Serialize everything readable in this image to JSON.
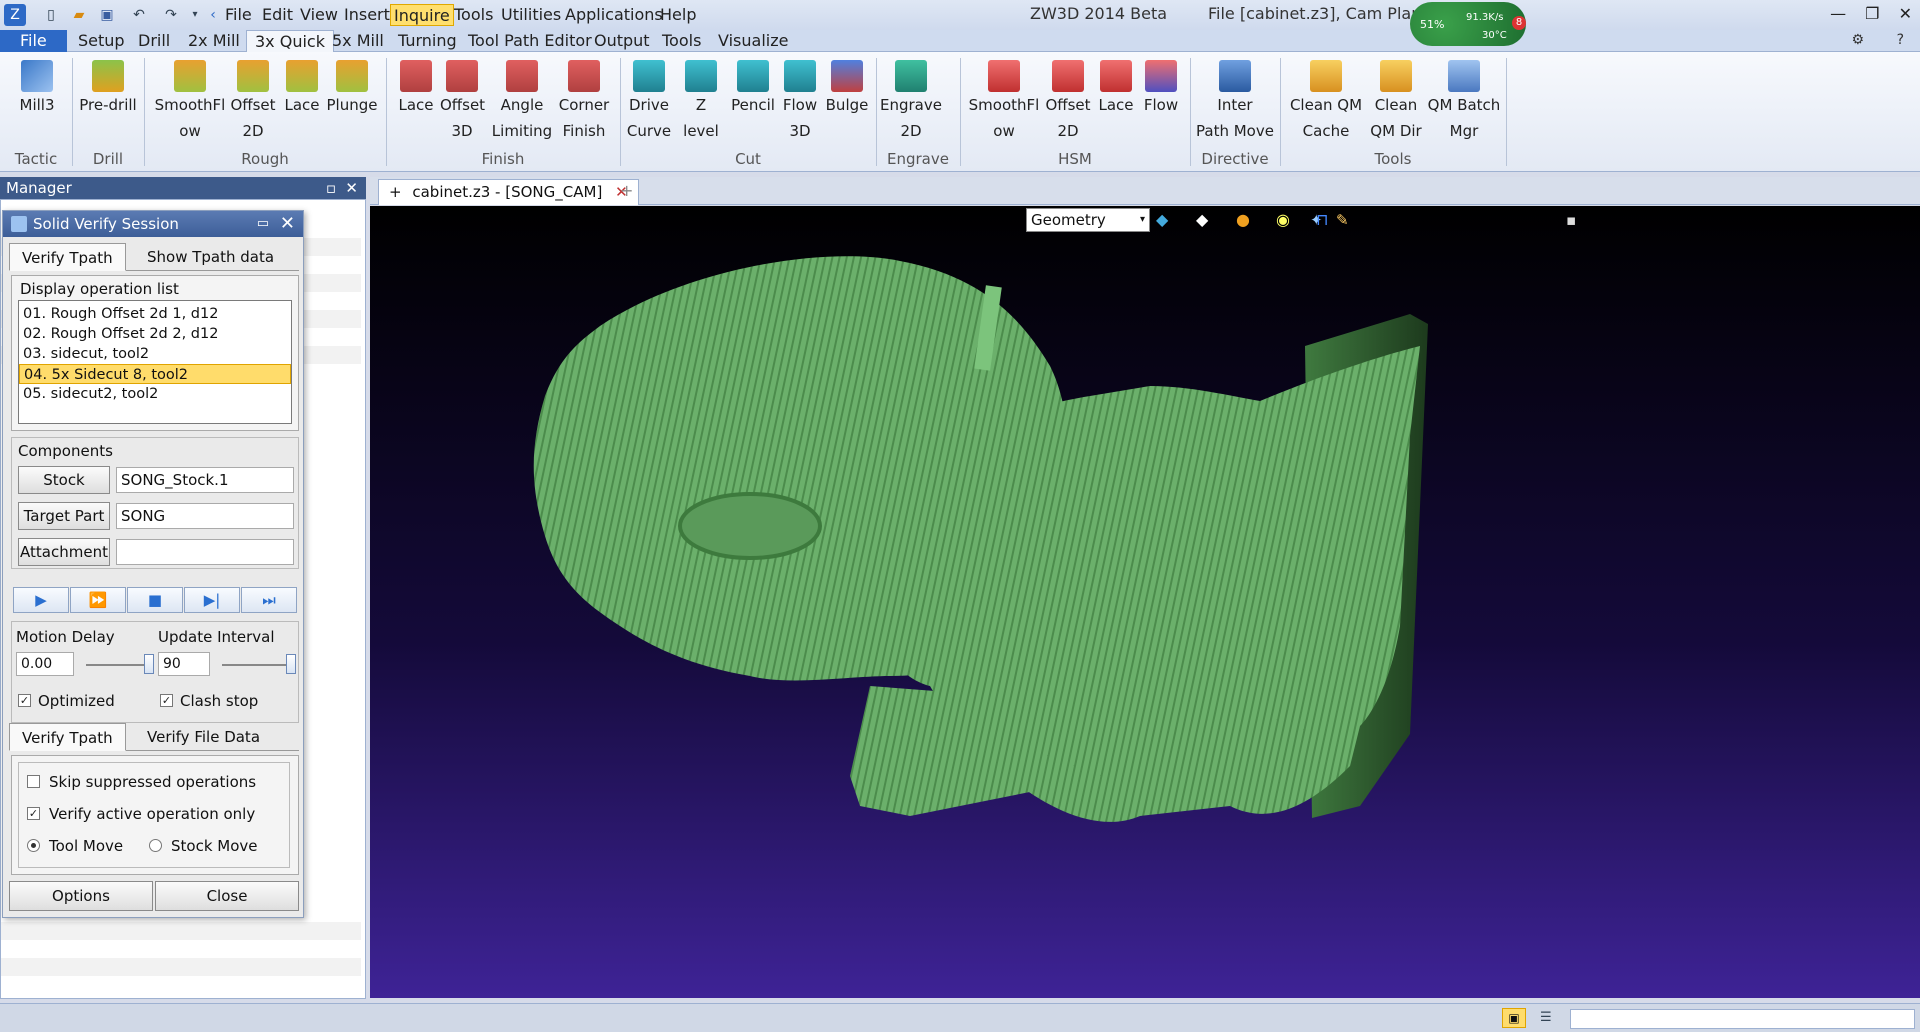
{
  "titlebar": {
    "app_title": "ZW3D 2014 Beta",
    "file_info": "File [cabinet.z3],  Cam Plan [SONG_CAM]",
    "menu": [
      "File",
      "Edit",
      "View",
      "Insert",
      "Inquire",
      "Tools",
      "Utilities",
      "Applications",
      "Help"
    ],
    "active_menu": "Inquire",
    "widget": {
      "cpu": "51%",
      "net": "91.3K/s",
      "temp": "30°C",
      "badge": "8"
    }
  },
  "ribbon_tabs": [
    "File",
    "Setup",
    "Drill",
    "2x Mill",
    "3x Quick",
    "5x Mill",
    "Turning",
    "Tool Path Editor",
    "Output",
    "Tools",
    "Visualize"
  ],
  "ribbon": {
    "buttons": [
      {
        "l1": "Mill3",
        "l2": "",
        "color": "#3a78c8"
      },
      {
        "l1": "Pre-drill",
        "l2": "",
        "color": "#e0a020"
      },
      {
        "l1": "SmoothFl",
        "l2": "ow",
        "color": "#d8c040"
      },
      {
        "l1": "Offset",
        "l2": "2D",
        "color": "#d8c040"
      },
      {
        "l1": "Lace",
        "l2": "",
        "color": "#d8c040"
      },
      {
        "l1": "Plunge",
        "l2": "",
        "color": "#d8c040"
      },
      {
        "l1": "Lace",
        "l2": "",
        "color": "#c05050"
      },
      {
        "l1": "Offset",
        "l2": "3D",
        "color": "#c05050"
      },
      {
        "l1": "Angle",
        "l2": "Limiting",
        "color": "#c05050"
      },
      {
        "l1": "Corner",
        "l2": "Finish",
        "color": "#c05050"
      },
      {
        "l1": "Drive",
        "l2": "Curve",
        "color": "#30a0b0"
      },
      {
        "l1": "Z level",
        "l2": "",
        "color": "#30a0b0"
      },
      {
        "l1": "Pencil",
        "l2": "",
        "color": "#30a0b0"
      },
      {
        "l1": "Flow",
        "l2": "3D",
        "color": "#30a0b0"
      },
      {
        "l1": "Bulge",
        "l2": "",
        "color": "#3060c0"
      },
      {
        "l1": "Engrave",
        "l2": "2D",
        "color": "#30a0b0"
      },
      {
        "l1": "SmoothFl",
        "l2": "ow",
        "color": "#d04848"
      },
      {
        "l1": "Offset",
        "l2": "2D",
        "color": "#d04848"
      },
      {
        "l1": "Lace",
        "l2": "",
        "color": "#d04848"
      },
      {
        "l1": "Flow",
        "l2": "",
        "color": "#d04848"
      },
      {
        "l1": "Inter",
        "l2": "Path Move",
        "color": "#3a78c8"
      },
      {
        "l1": "Clean QM",
        "l2": "Cache",
        "color": "#e8b830"
      },
      {
        "l1": "Clean",
        "l2": "QM Dir",
        "color": "#e8b830"
      },
      {
        "l1": "QM Batch",
        "l2": "Mgr",
        "color": "#5a8ad0"
      }
    ],
    "groups": [
      "Tactic",
      "Drill",
      "Rough",
      "Finish",
      "Cut",
      "Engrave",
      "HSM",
      "Directive",
      "Tools"
    ]
  },
  "manager": {
    "title": "Manager"
  },
  "dialog": {
    "title": "Solid Verify Session",
    "tabs1": [
      "Verify Tpath",
      "Show Tpath data"
    ],
    "oplist_label": "Display operation list",
    "operations": [
      "01. Rough Offset 2d 1, d12",
      "02. Rough Offset 2d 2, d12",
      "03. sidecut, tool2",
      "04. 5x Sidecut 8, tool2",
      "05. sidecut2, tool2"
    ],
    "selected_op": "04. 5x Sidecut 8, tool2",
    "components_label": "Components",
    "stock_btn": "Stock",
    "stock_val": "SONG_Stock.1",
    "target_btn": "Target Part",
    "target_val": "SONG",
    "attach_btn": "Attachment",
    "attach_val": "",
    "motion_delay_label": "Motion Delay",
    "motion_delay_val": "0.00",
    "motion_delay_level": 1.0,
    "update_interval_label": "Update Interval",
    "update_interval_val": "90",
    "update_interval_level": 1.0,
    "optimized_label": "Optimized",
    "optimized_checked": true,
    "clash_label": "Clash stop",
    "clash_checked": true,
    "tabs2": [
      "Verify Tpath",
      "Verify File Data"
    ],
    "skip_label": "Skip suppressed operations",
    "skip_checked": false,
    "verify_active_label": "Verify active operation only",
    "verify_active_checked": true,
    "toolmove_label": "Tool Move",
    "stockmove_label": "Stock Move",
    "move_mode": "Tool Move",
    "options_btn": "Options",
    "close_btn": "Close"
  },
  "document": {
    "tab_title": "cabinet.z3 - [SONG_CAM]",
    "geometry_filter": "Geometry"
  },
  "colors": {
    "model": "#6bb06b",
    "bg_top": "#000000",
    "bg_bottom": "#3e2396",
    "accent": "#2d69c6",
    "highlight": "#ffdc6b"
  }
}
